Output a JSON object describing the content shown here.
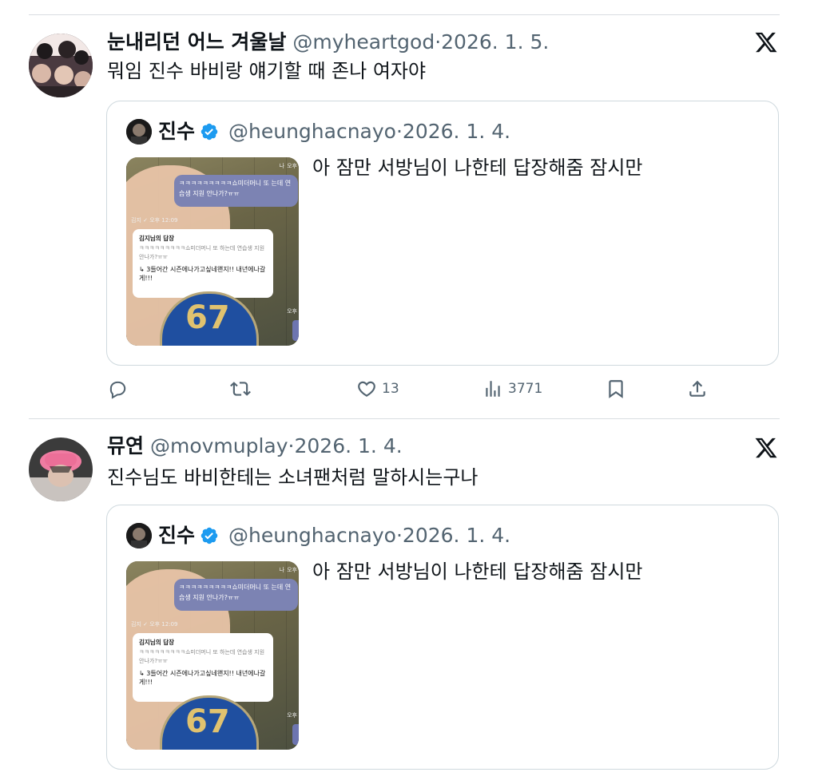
{
  "tweet1": {
    "name": "눈내리던 어느 겨울날",
    "handle": "@myheartgod",
    "dot": "·",
    "date": "2026. 1. 5.",
    "text": "뭐임 진수 바비랑 얘기할 때 존나 여자야",
    "quote": {
      "name": "진수",
      "handle": "@heunghacnayo",
      "dot": "·",
      "date": "2026. 1. 4.",
      "text": "아 잠만 서방님이 나한테 답장해줌 잠시만",
      "image": {
        "bubble_text": "ㅋㅋㅋㅋㅋㅋㅋㅋㅋ쇼미더머니 또 는데 연습생 지원 안나가?ㅠㅠ",
        "sender_meta": "김지 ✓ 오후 12:09",
        "label_na": "나",
        "label_time": "오후",
        "reply_title": "김지님의 답장",
        "reply_quote": "ㅋㅋㅋㅋㅋㅋㅋㅋㅋ쇼미더머니 또 하는데 연습생 지원 안나가?ㅠㅠ",
        "reply_text": "↳ 3들어간 시즌에나가고싶네왠지!! 내년에나갈게!!!",
        "badge_number": "67"
      }
    },
    "actions": {
      "reply_icon": "reply-icon",
      "retweet_icon": "retweet-icon",
      "like_icon": "heart-icon",
      "like_count": "13",
      "views_icon": "views-icon",
      "views_count": "3771",
      "bookmark_icon": "bookmark-icon",
      "share_icon": "share-icon"
    }
  },
  "tweet2": {
    "name": "뮤연",
    "handle": "@movmuplay",
    "dot": "·",
    "date": "2026. 1. 4.",
    "text": "진수님도 바비한테는 소녀팬처럼 말하시는구나",
    "quote": {
      "name": "진수",
      "handle": "@heunghacnayo",
      "dot": "·",
      "date": "2026. 1. 4.",
      "text": "아 잠만 서방님이 나한테 답장해줌 잠시만",
      "image": {
        "bubble_text": "ㅋㅋㅋㅋㅋㅋㅋㅋㅋ쇼미더머니 또 는데 연습생 지원 안나가?ㅠㅠ",
        "sender_meta": "김지 ✓ 오후 12:09",
        "label_na": "나",
        "label_time": "오후",
        "reply_title": "김지님의 답장",
        "reply_quote": "ㅋㅋㅋㅋㅋㅋㅋㅋㅋ쇼미더머니 또 하는데 연습생 지원 안나가?ㅠㅠ",
        "reply_text": "↳ 3들어간 시즌에나가고싶네왠지!! 내년에나갈게!!!",
        "badge_number": "67"
      }
    }
  },
  "colors": {
    "text": "#0f1419",
    "secondary": "#536471",
    "border": "#cfd9de",
    "verified": "#1d9bf0"
  }
}
